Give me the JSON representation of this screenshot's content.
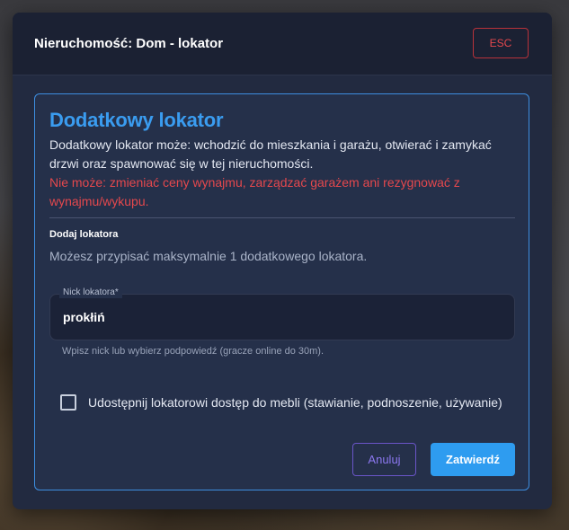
{
  "header": {
    "title": "Nieruchomość: Dom - lokator",
    "esc_label": "ESC"
  },
  "card": {
    "title": "Dodatkowy lokator",
    "description": "Dodatkowy lokator może: wchodzić do mieszkania i garażu, otwierać i zamykać drzwi oraz spawnować się w tej nieruchomości.",
    "warning": "Nie może: zmieniać ceny wynajmu, zarządzać garażem ani rezygnować z wynajmu/wykupu.",
    "section_label": "Dodaj lokatora",
    "section_hint": "Możesz przypisać maksymalnie 1 dodatkowego lokatora."
  },
  "nick_field": {
    "label": "Nick lokatora",
    "required_mark": "*",
    "value": "prokłiń",
    "helper": "Wpisz nick lub wybierz podpowiedź (gracze online do 30m)."
  },
  "furniture_checkbox": {
    "label": "Udostępnij lokatorowi dostęp do mebli (stawianie, podnoszenie, używanie)",
    "checked": false
  },
  "actions": {
    "cancel_label": "Anuluj",
    "confirm_label": "Zatwierdź"
  },
  "colors": {
    "accent": "#3a9cf0",
    "danger": "#e5484d",
    "cancel": "#8c78f0",
    "modal_bg": "#222a40"
  }
}
